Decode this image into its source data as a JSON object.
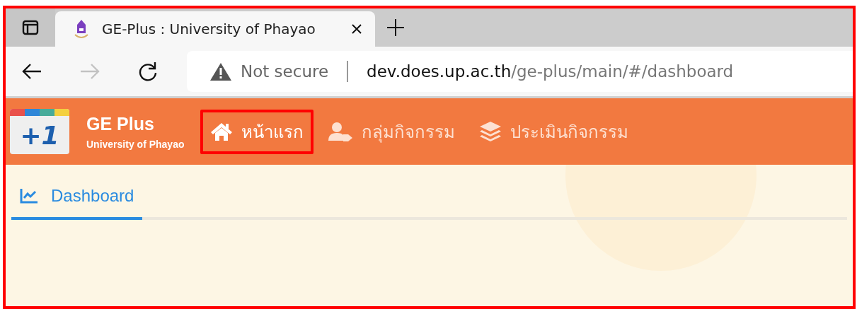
{
  "browser": {
    "tab": {
      "title": "GE-Plus : University of Phayao",
      "selected": true
    },
    "back": {
      "disabled": false
    },
    "forward": {
      "disabled": true
    },
    "address": {
      "security": "Not secure",
      "host": "dev.does.up.ac.th",
      "path": "/ge-plus/main/#/dashboard"
    }
  },
  "app": {
    "logo": {
      "mark": "+1"
    },
    "title": "GE Plus",
    "subtitle": "University of Phayao",
    "nav": [
      {
        "label": "หน้าแรก",
        "kind": "home",
        "highlighted": true
      },
      {
        "label": "กลุ่มกิจกรรม",
        "kind": "group",
        "highlighted": false
      },
      {
        "label": "ประเมินกิจกรรม",
        "kind": "assessment",
        "highlighted": false
      }
    ]
  },
  "tabs": [
    {
      "label": "Dashboard",
      "selected": true
    }
  ]
}
